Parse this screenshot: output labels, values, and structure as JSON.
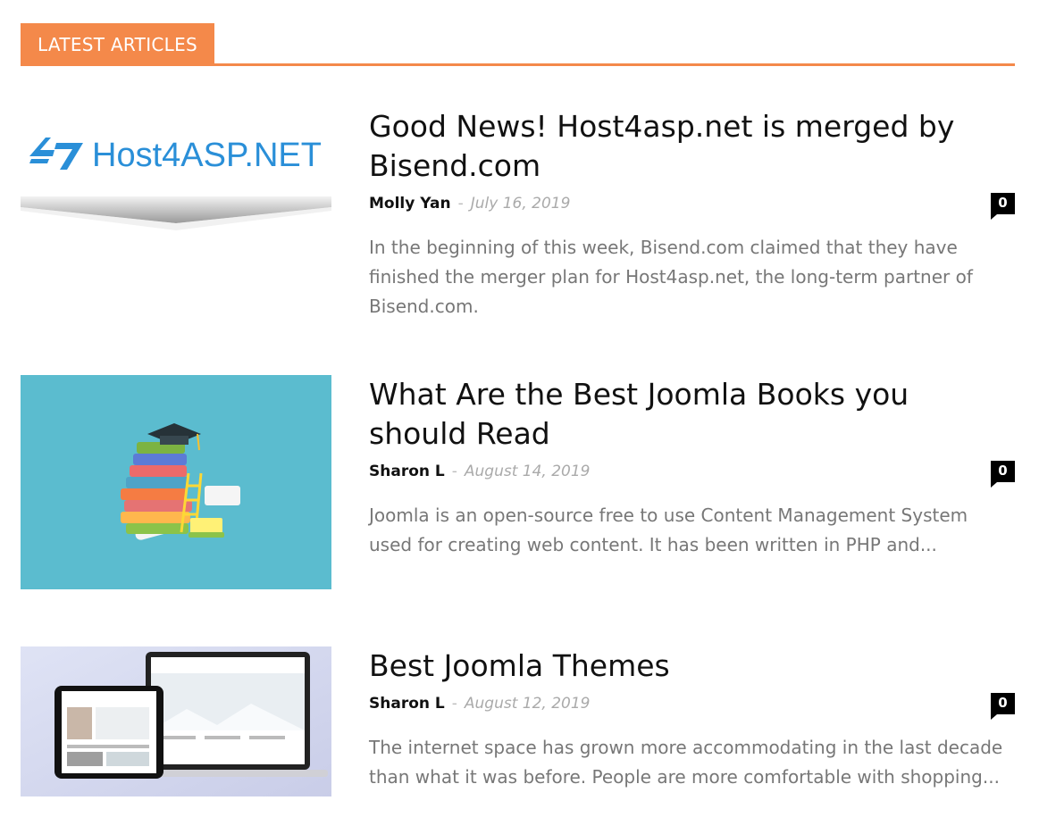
{
  "section": {
    "title": "LATEST ARTICLES",
    "accent_color": "#f4894a"
  },
  "articles": [
    {
      "title": "Good News! Host4asp.net is merged by Bisend.com",
      "author": "Molly Yan",
      "separator": "-",
      "date": "July 16, 2019",
      "comments": "0",
      "excerpt": "In the beginning of this week, Bisend.com claimed that they have finished the merger plan for Host4asp.net, the long-term partner of Bisend.com.",
      "image": {
        "icon": "host4asp-logo",
        "logo_text": "Host4ASP.NET"
      }
    },
    {
      "title": "What Are the Best Joomla Books you should Read",
      "author": "Sharon L",
      "separator": "-",
      "date": "August 14, 2019",
      "comments": "0",
      "excerpt": "Joomla is an open-source free to use Content Management System used for creating web content. It has been written in PHP and...",
      "image": {
        "icon": "book-stack-graduation-cap",
        "background": "#5bbccf"
      }
    },
    {
      "title": "Best Joomla Themes",
      "author": "Sharon L",
      "separator": "-",
      "date": "August 12, 2019",
      "comments": "0",
      "excerpt": "The internet space has grown more accommodating in the last decade than what it was before. People are more comfortable with shopping...",
      "image": {
        "icon": "laptop-tablet-mockup"
      }
    }
  ]
}
